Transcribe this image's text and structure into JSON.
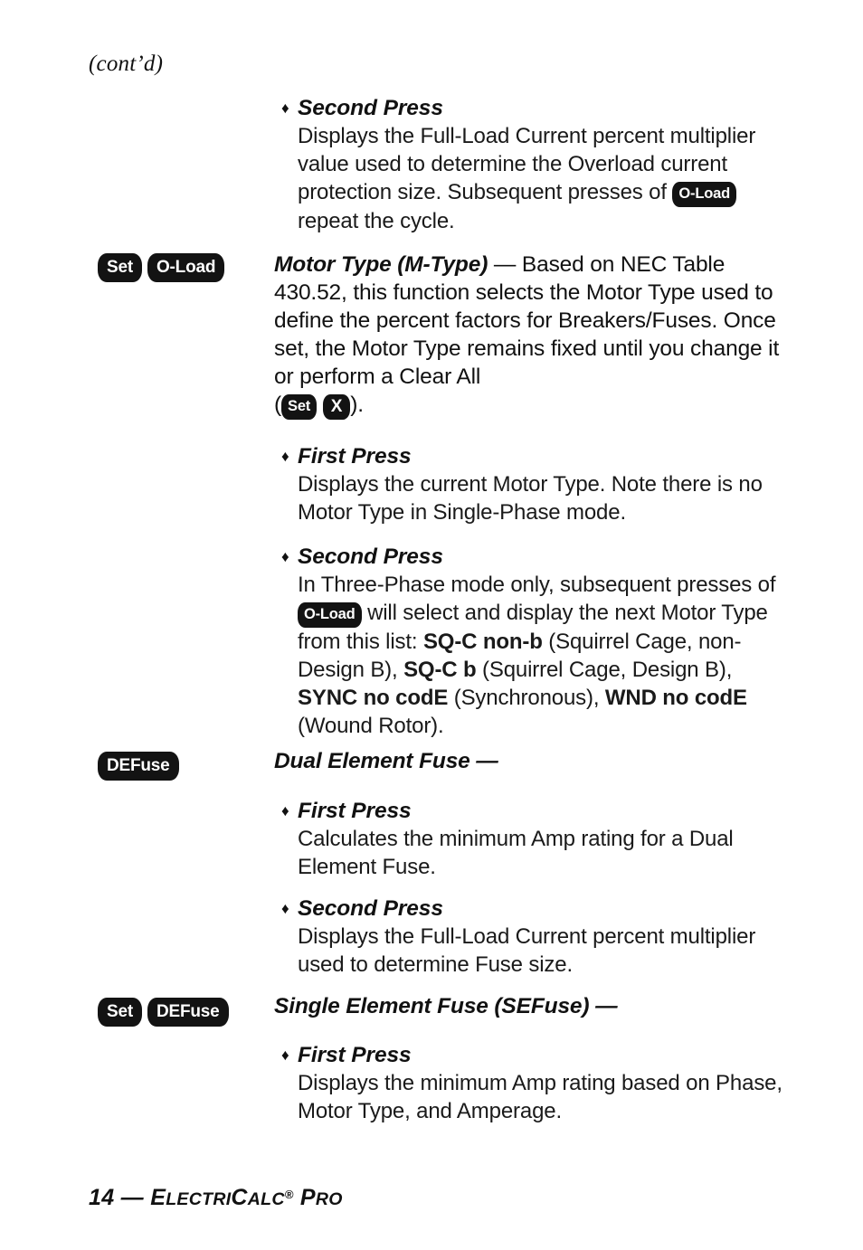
{
  "page": {
    "continuation_note": "(cont’d)",
    "footer": {
      "page_number": "14",
      "dash": " — ",
      "brand_e": "E",
      "brand_lectri": "LECTRI",
      "brand_c": "C",
      "brand_alc": "ALC",
      "registered": "®",
      "pro_p": "P",
      "pro_ro": "RO"
    }
  },
  "keys": {
    "set": "Set",
    "oload": "O-Load",
    "x": "X",
    "defuse": "DEFuse"
  },
  "sections": [
    {
      "id": "overload-second-press",
      "bullet": "♦",
      "heading": "Second Press",
      "text_before_key": "Displays the Full-Load Current percent multiplier value used to determine the Overload current protection size. Subsequent presses of ",
      "text_after_key": " repeat the cycle."
    },
    {
      "id": "motor-type",
      "gutter_keys": [
        "Set",
        "O-Load"
      ],
      "heading_italic": "Motor Type (M-Type) ",
      "heading_rest": "— Based on NEC Table 430.52, this function selects the Motor Type used to define the percent factors for Breakers/Fuses. Once set, the Motor Type remains fixed until you change it or perform a Clear All",
      "paren_open": "(",
      "paren_close": ").",
      "keys_inline": [
        "Set",
        "X"
      ]
    },
    {
      "id": "motor-type-first-press",
      "bullet": "♦",
      "heading": "First Press",
      "text": "Displays the current Motor Type. Note there is no Motor Type in Single-Phase mode."
    },
    {
      "id": "motor-type-second-press",
      "bullet": "♦",
      "heading": "Second Press",
      "text_before_key": "In Three-Phase mode only, subsequent presses of ",
      "text_after_key": " will select and display the next Motor Type from this list: ",
      "motor_types": [
        {
          "code": "SQ-C non-b",
          "desc": " (Squirrel Cage, non-Design B), "
        },
        {
          "code": "SQ-C b",
          "desc": " (Squirrel Cage, Design B), "
        },
        {
          "code": "SYNC no codE",
          "desc": " (Synchronous), "
        },
        {
          "code": "WND no codE",
          "desc": " (Wound Rotor)."
        }
      ]
    },
    {
      "id": "dual-element-fuse",
      "gutter_keys": [
        "DEFuse"
      ],
      "heading_italic": "Dual Element Fuse —"
    },
    {
      "id": "defuse-first-press",
      "bullet": "♦",
      "heading": "First Press",
      "text": "Calculates the minimum Amp rating for a Dual Element Fuse."
    },
    {
      "id": "defuse-second-press",
      "bullet": "♦",
      "heading": "Second Press",
      "text": "Displays the Full-Load Current percent multiplier used to determine Fuse size."
    },
    {
      "id": "single-element-fuse",
      "gutter_keys": [
        "Set",
        "DEFuse"
      ],
      "heading_italic": "Single Element Fuse (SEFuse) —"
    },
    {
      "id": "sefuse-first-press",
      "bullet": "♦",
      "heading": "First Press",
      "text": "Displays the minimum Amp rating based on Phase, Motor Type, and Amperage."
    }
  ]
}
